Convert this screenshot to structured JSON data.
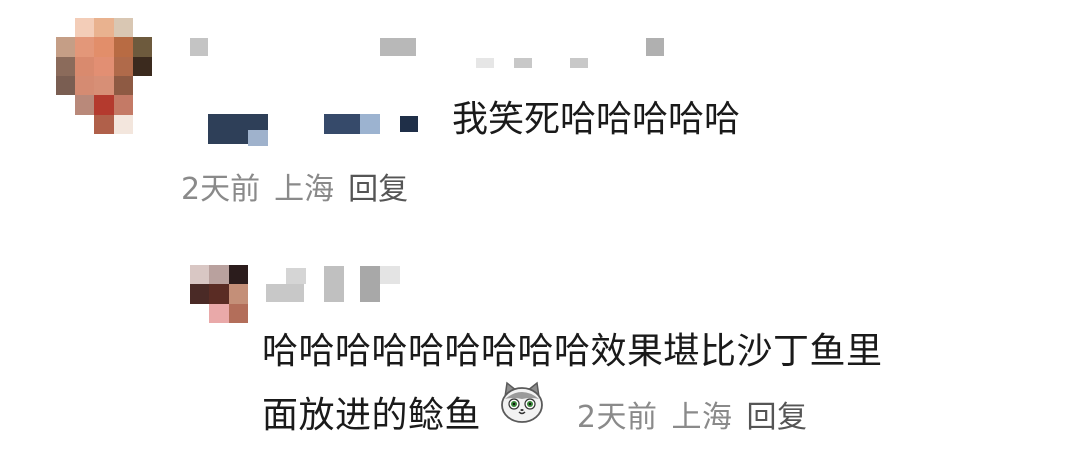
{
  "comment": {
    "text": "我笑死哈哈哈哈哈",
    "time": "2天前",
    "location": "上海",
    "reply_label": "回复"
  },
  "reply": {
    "text_line1": "哈哈哈哈哈哈哈哈哈效果堪比沙丁鱼里",
    "text_line2": "面放进的鲶鱼",
    "emoji": "cat-emoji",
    "time": "2天前",
    "location": "上海",
    "reply_label": "回复"
  },
  "colors": {
    "meta_gray": "#8a8a8a",
    "text": "#1a1a1a",
    "background": "#ffffff"
  }
}
